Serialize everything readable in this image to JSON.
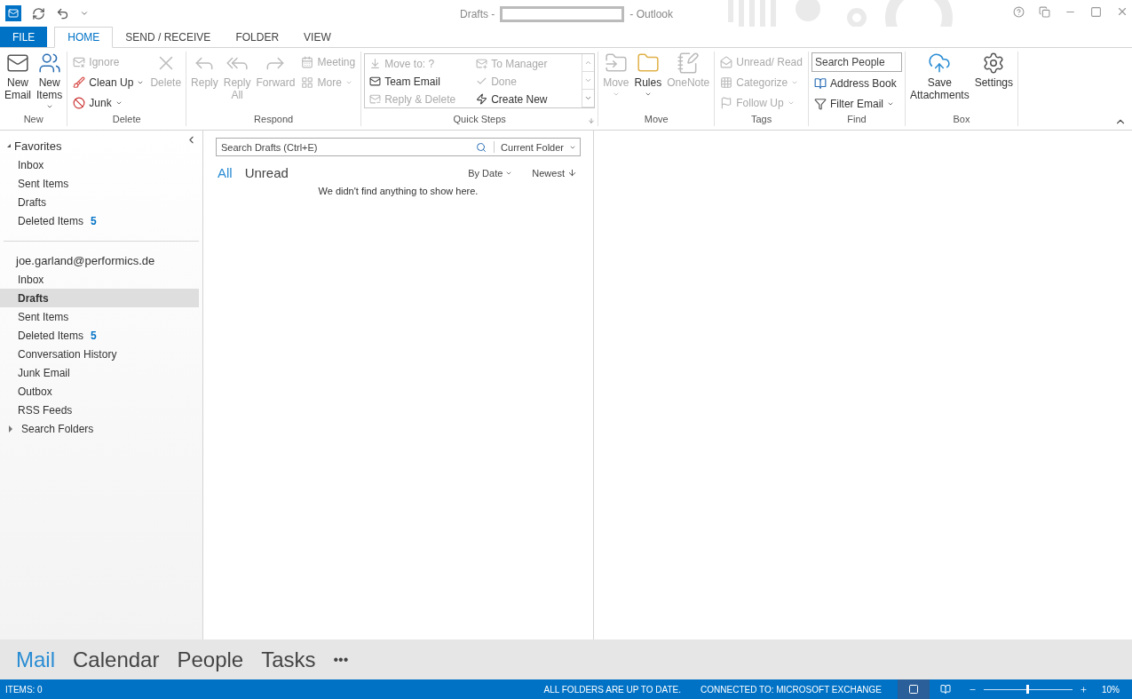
{
  "window": {
    "title_prefix": "Drafts -",
    "title_suffix": "- Outlook"
  },
  "ribbon_tabs": [
    {
      "label": "FILE",
      "kind": "file",
      "selected": false
    },
    {
      "label": "HOME",
      "kind": "tab",
      "selected": true
    },
    {
      "label": "SEND / RECEIVE",
      "kind": "tab",
      "selected": false
    },
    {
      "label": "FOLDER",
      "kind": "tab",
      "selected": false
    },
    {
      "label": "VIEW",
      "kind": "tab",
      "selected": false
    }
  ],
  "ribbon_groups": [
    {
      "label": "New",
      "items": [
        {
          "kind": "large",
          "label": "New Email",
          "disabled": false,
          "dropdown": false
        },
        {
          "kind": "large",
          "label": "New Items",
          "disabled": false,
          "dropdown": true
        }
      ]
    },
    {
      "label": "Delete",
      "items": [
        {
          "kind": "column",
          "items": [
            {
              "kind": "small",
              "label": "Ignore",
              "disabled": true,
              "dropdown": false
            },
            {
              "kind": "small",
              "label": "Clean Up",
              "disabled": false,
              "dropdown": true
            },
            {
              "kind": "small",
              "label": "Junk",
              "disabled": false,
              "dropdown": true
            }
          ]
        },
        {
          "kind": "large",
          "label": "Delete",
          "disabled": true,
          "dropdown": false
        }
      ]
    },
    {
      "label": "Respond",
      "items": [
        {
          "kind": "large",
          "label": "Reply",
          "disabled": true,
          "dropdown": false
        },
        {
          "kind": "large",
          "label": "Reply All",
          "disabled": true,
          "dropdown": false
        },
        {
          "kind": "large",
          "label": "Forward",
          "disabled": true,
          "dropdown": false
        },
        {
          "kind": "column",
          "items": [
            {
              "kind": "small",
              "label": "Meeting",
              "disabled": true,
              "dropdown": false
            },
            {
              "kind": "small",
              "label": "More",
              "disabled": true,
              "dropdown": true
            }
          ]
        }
      ]
    },
    {
      "label": "Quick Steps",
      "launcher": true,
      "items": [
        {
          "kind": "gallery",
          "items": [
            {
              "label": "Move to: ?",
              "disabled": true
            },
            {
              "label": "Team Email",
              "disabled": false
            },
            {
              "label": "Reply & Delete",
              "disabled": true
            },
            {
              "label": "To Manager",
              "disabled": true
            },
            {
              "label": "Done",
              "disabled": true
            },
            {
              "label": "Create New",
              "disabled": false
            }
          ]
        }
      ]
    },
    {
      "label": "Move",
      "items": [
        {
          "kind": "large",
          "label": "Move",
          "disabled": true,
          "dropdown": true
        },
        {
          "kind": "large",
          "label": "Rules",
          "disabled": false,
          "dropdown": true
        },
        {
          "kind": "large",
          "label": "OneNote",
          "disabled": true,
          "dropdown": false
        }
      ]
    },
    {
      "label": "Tags",
      "items": [
        {
          "kind": "column",
          "items": [
            {
              "kind": "small",
              "label": "Unread/ Read",
              "disabled": true,
              "dropdown": false
            },
            {
              "kind": "small",
              "label": "Categorize",
              "disabled": true,
              "dropdown": true
            },
            {
              "kind": "small",
              "label": "Follow Up",
              "disabled": true,
              "dropdown": true
            }
          ]
        }
      ]
    },
    {
      "label": "Find",
      "items": [
        {
          "kind": "column",
          "items": [
            {
              "kind": "search",
              "placeholder": "Search People"
            },
            {
              "kind": "small",
              "label": "Address Book",
              "disabled": false,
              "dropdown": false
            },
            {
              "kind": "small",
              "label": "Filter Email",
              "disabled": false,
              "dropdown": true
            }
          ]
        }
      ]
    },
    {
      "label": "Box",
      "items": [
        {
          "kind": "large",
          "label": "Save Attachments",
          "disabled": false,
          "dropdown": false
        },
        {
          "kind": "large",
          "label": "Settings",
          "disabled": false,
          "dropdown": false
        }
      ]
    }
  ],
  "sidebar": {
    "sections": [
      {
        "label": "Favorites",
        "expanded": true,
        "children": [
          {
            "label": "Inbox",
            "selected": false
          },
          {
            "label": "Sent Items",
            "selected": false
          },
          {
            "label": "Drafts",
            "selected": false
          },
          {
            "label": "Deleted Items",
            "count": "5",
            "selected": false
          }
        ]
      },
      {
        "label": "joe.garland@performics.de",
        "children": [
          {
            "label": "Inbox",
            "selected": false
          },
          {
            "label": "Drafts",
            "selected": true
          },
          {
            "label": "Sent Items",
            "selected": false
          },
          {
            "label": "Deleted Items",
            "count": "5",
            "selected": false
          },
          {
            "label": "Conversation History",
            "selected": false
          },
          {
            "label": "Junk Email",
            "selected": false
          },
          {
            "label": "Outbox",
            "selected": false
          },
          {
            "label": "RSS Feeds",
            "selected": false
          },
          {
            "label": "Search Folders",
            "expanded": false,
            "selected": false
          }
        ]
      }
    ]
  },
  "message_list": {
    "search": {
      "placeholder": "Search Drafts (Ctrl+E)",
      "scope": "Current Folder"
    },
    "filters": [
      {
        "label": "All",
        "selected": true
      },
      {
        "label": "Unread",
        "selected": false
      }
    ],
    "sort": {
      "by": "By Date",
      "order": "Newest"
    },
    "empty_message": "We didn't find anything to show here."
  },
  "nav": [
    {
      "label": "Mail",
      "selected": true
    },
    {
      "label": "Calendar",
      "selected": false
    },
    {
      "label": "People",
      "selected": false
    },
    {
      "label": "Tasks",
      "selected": false
    }
  ],
  "nav_more": "•••",
  "status_bar": {
    "items": "ITEMS: 0",
    "sync": "ALL FOLDERS ARE UP TO DATE.",
    "connection": "CONNECTED TO: MICROSOFT EXCHANGE",
    "zoom": {
      "level": 0.48,
      "reading": "10%"
    }
  }
}
